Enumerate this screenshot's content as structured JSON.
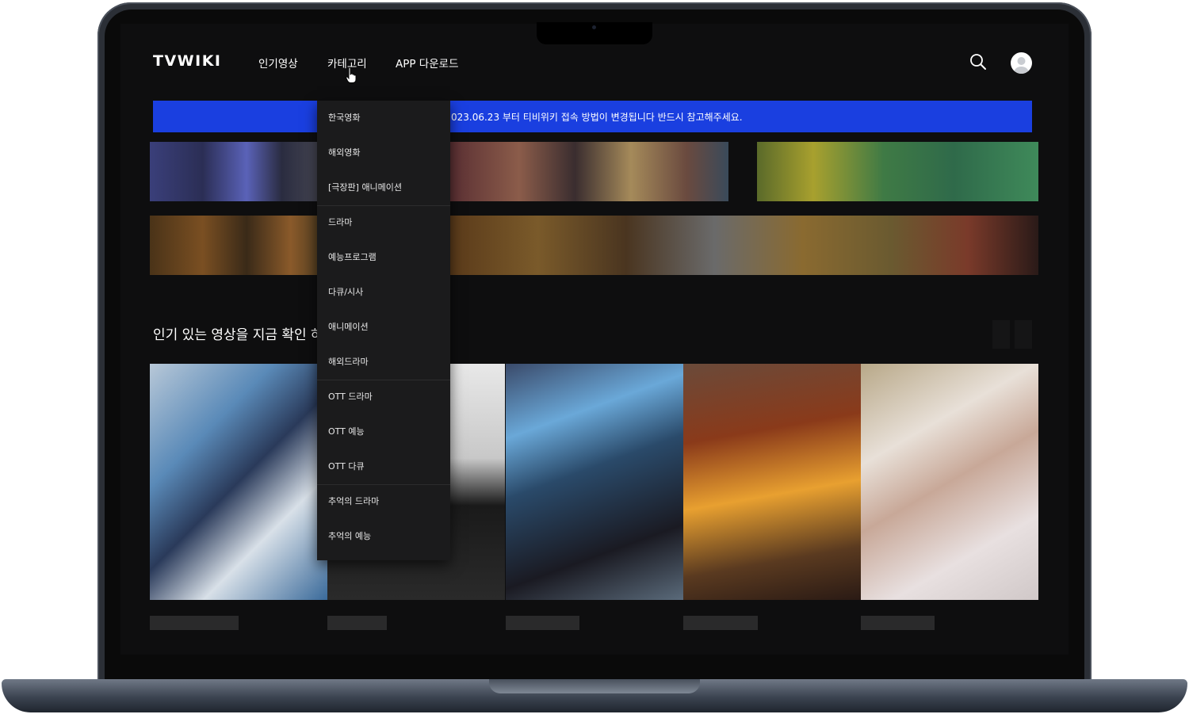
{
  "header": {
    "logo": "TVWIKI",
    "nav": [
      {
        "label": "인기영상"
      },
      {
        "label": "카테고리"
      },
      {
        "label": "APP 다운로드"
      }
    ]
  },
  "icons": {
    "search": "search-icon",
    "user": "user-avatar-icon",
    "pointer": "hand-pointer-cursor"
  },
  "notice": {
    "text": "023.06.23 부터 티비위키 접속 방법이 변경됩니다 반드시 참고해주세요."
  },
  "dropdown": {
    "items": [
      {
        "label": "한국영화"
      },
      {
        "label": "해외영화"
      },
      {
        "label": "[극장판] 애니메이션"
      },
      {
        "label": "드라마"
      },
      {
        "label": "예능프로그램"
      },
      {
        "label": "다큐/시사"
      },
      {
        "label": "애니메이션"
      },
      {
        "label": "해외드라마"
      },
      {
        "label": "OTT 드라마"
      },
      {
        "label": "OTT 예능"
      },
      {
        "label": "OTT 다큐"
      },
      {
        "label": "추억의 드라마"
      },
      {
        "label": "추억의 예능"
      }
    ]
  },
  "section": {
    "title": "인기 있는 영상을 지금 확인 하"
  },
  "colors": {
    "page_bg": "#0e0e0f",
    "notice_bg": "#1a3fe0",
    "dropdown_bg": "#1b1b1c",
    "text": "#ffffff"
  }
}
